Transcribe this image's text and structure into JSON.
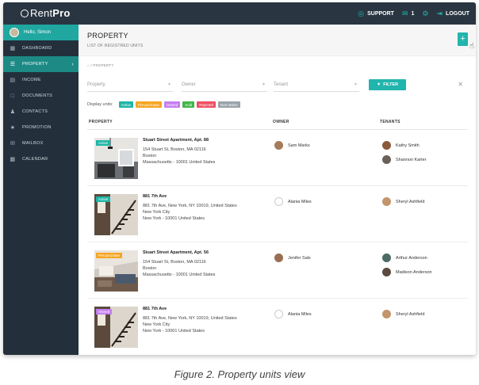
{
  "topbar": {
    "logo_thin": "Rent",
    "logo_bold": "Pro",
    "support_label": "SUPPORT",
    "mail_count": "1",
    "logout_label": "LOGOUT"
  },
  "sidebar": {
    "greeting": "Hello, Simon",
    "items": [
      {
        "label": "DASHBOARD",
        "icon": "dashboard-icon"
      },
      {
        "label": "PROPERTY",
        "icon": "property-icon"
      },
      {
        "label": "INCOME",
        "icon": "income-icon"
      },
      {
        "label": "DOCUMENTS",
        "icon": "documents-icon"
      },
      {
        "label": "CONTACTS",
        "icon": "contacts-icon"
      },
      {
        "label": "PROMOTION",
        "icon": "promotion-icon"
      },
      {
        "label": "MAILBOX",
        "icon": "mailbox-icon"
      },
      {
        "label": "CALENDAR",
        "icon": "calendar-icon"
      }
    ]
  },
  "header": {
    "title": "PROPERTY",
    "subtitle": "LIST OF REGISTRED UNITS",
    "add_label": "+"
  },
  "breadcrumb": "PROPERTY",
  "filters": {
    "property_placeholder": "Property",
    "owner_placeholder": "Owner",
    "tenant_placeholder": "Tenant",
    "filter_label": "FILTER"
  },
  "display_units": {
    "label": "Display units:",
    "badges": [
      {
        "label": "Active",
        "color": "#1fb5a7"
      },
      {
        "label": "Pre-purchase",
        "color": "#f5a623"
      },
      {
        "label": "Owned",
        "color": "#c47ef0"
      },
      {
        "label": "Sold",
        "color": "#3fb64a"
      },
      {
        "label": "Rejected",
        "color": "#ef4f63"
      },
      {
        "label": "Non-select",
        "color": "#9aa3a9"
      }
    ]
  },
  "table": {
    "headers": {
      "property": "PROPERTY",
      "owner": "OWNER",
      "tenants": "TENANTS"
    },
    "rows": [
      {
        "status": "Active",
        "status_color": "#1fb5a7",
        "title": "Stuart Street Apartment, Apt. 88",
        "address": "154 Stuart St, Boston, MA 02116",
        "city": "Boston",
        "region": "Massachusetts - 10001 United States",
        "owner": "Sam Marks",
        "tenants": [
          "Kathy Smith",
          "Shannon Karter"
        ]
      },
      {
        "status": "Active",
        "status_color": "#1fb5a7",
        "title": "881 7th Ave",
        "address": "881 7th Ave, New York, NY 10019, United States",
        "city": "New York City",
        "region": "New York - 10001 United States",
        "owner": "Alania Miles",
        "tenants": [
          "Sheryl Ashfield"
        ]
      },
      {
        "status": "Pre-purchase",
        "status_color": "#f5a623",
        "title": "Stuart Street Apartment, Apt. 56",
        "address": "154 Stuart St, Boston, MA 02116",
        "city": "Boston",
        "region": "Massachusetts - 10001 United States",
        "owner": "Jenifer Sals",
        "tenants": [
          "Arthur Anderson",
          "Madison Anderson"
        ]
      },
      {
        "status": "Owned",
        "status_color": "#c47ef0",
        "title": "881 7th Ave",
        "address": "881 7th Ave, New York, NY 10019, United States",
        "city": "New York City",
        "region": "New York - 10001 United States",
        "owner": "Alania Miles",
        "tenants": [
          "Sheryl Ashfield"
        ]
      }
    ]
  },
  "caption": "Figure 2. Property units view"
}
